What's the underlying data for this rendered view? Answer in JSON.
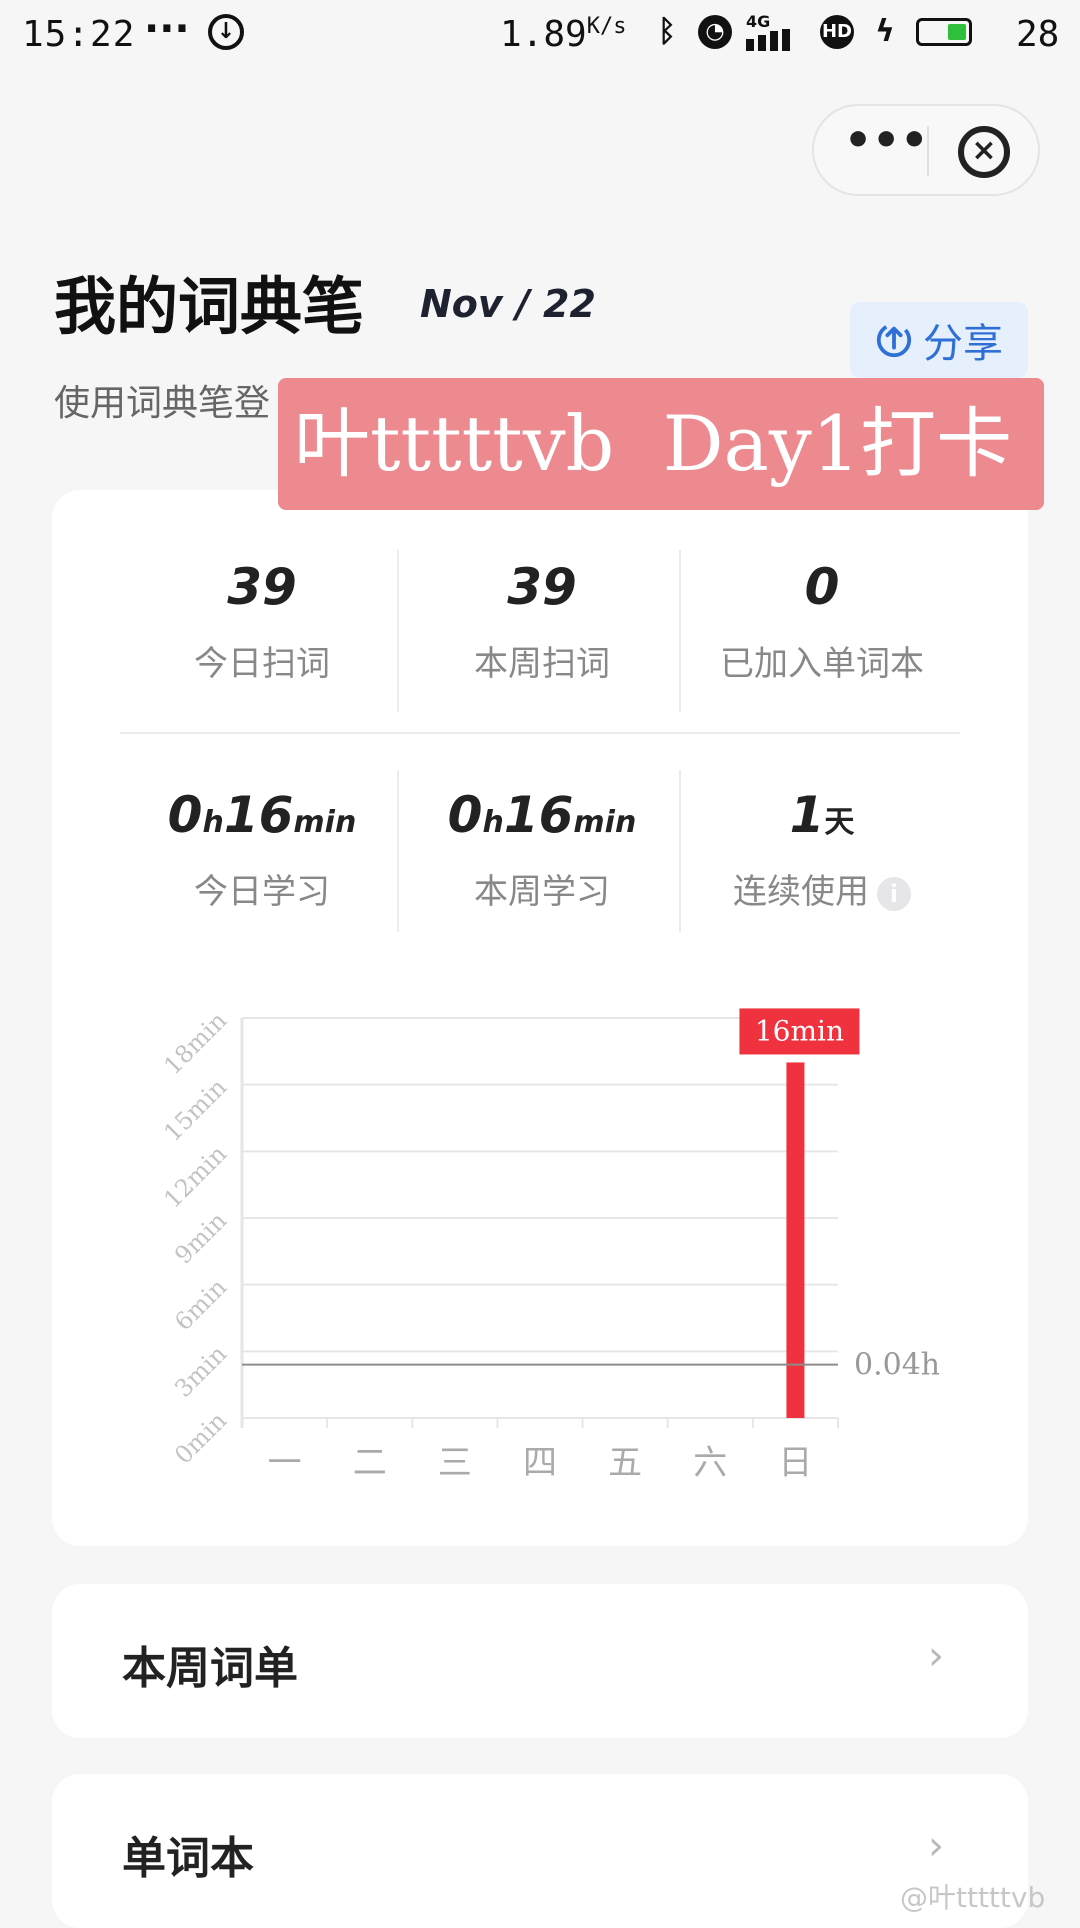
{
  "status_bar": {
    "time": "15:22",
    "dots": "···",
    "speed": "1.89",
    "speed_unit": "K/s",
    "network": "4G",
    "hd": "HD",
    "battery": "28",
    "icons": [
      "download-icon",
      "bluetooth-icon",
      "alarm-icon",
      "signal-icon",
      "hd-icon",
      "charging-icon",
      "battery-icon"
    ]
  },
  "capsule": {
    "more": "•••",
    "close": "×"
  },
  "header": {
    "title": "我的词典笔",
    "date": "Nov / 22",
    "share_label": "分享",
    "subtitle": "使用词典笔登"
  },
  "overlay": {
    "text": "叶tttttvb  Day1打卡"
  },
  "stats": {
    "row1": [
      {
        "value": "39",
        "label": "今日扫词"
      },
      {
        "value": "39",
        "label": "本周扫词"
      },
      {
        "value": "0",
        "label": "已加入单词本"
      }
    ],
    "row2": [
      {
        "value_h": "0",
        "unit_h": "h",
        "value_m": "16",
        "unit_m": "min",
        "label": "今日学习"
      },
      {
        "value_h": "0",
        "unit_h": "h",
        "value_m": "16",
        "unit_m": "min",
        "label": "本周学习"
      },
      {
        "value": "1",
        "unit": "天",
        "label": "连续使用"
      }
    ]
  },
  "chart_data": {
    "type": "bar",
    "categories": [
      "一",
      "二",
      "三",
      "四",
      "五",
      "六",
      "日"
    ],
    "values": [
      0,
      0,
      0,
      0,
      0,
      0,
      16
    ],
    "y_ticks": [
      "0min",
      "3min",
      "6min",
      "9min",
      "12min",
      "15min",
      "18min"
    ],
    "ylim": [
      0,
      18
    ],
    "bar_label": "16min",
    "average_line": {
      "value": 2.4,
      "label": "0.04h"
    },
    "colors": {
      "bar": "#f0323e",
      "avg_line": "#8c8c8c",
      "grid": "#e6e6e8"
    },
    "grid": true
  },
  "lists": [
    {
      "label": "本周词单"
    },
    {
      "label": "单词本"
    }
  ],
  "watermark": "@叶tttttvb"
}
